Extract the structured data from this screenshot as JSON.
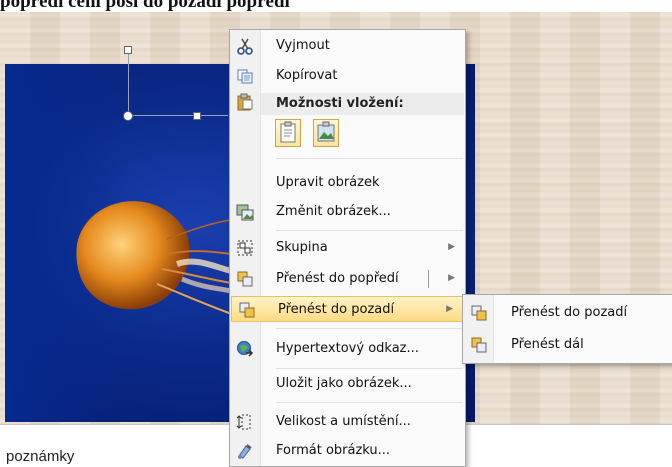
{
  "top_text": "popředí  čení  posl  do pozadí  popředí",
  "notes_label": "poznámky",
  "context_menu": {
    "cut": "Vyjmout",
    "copy": "Kopírovat",
    "paste_options_header": "Možnosti vložení:",
    "edit_picture": "Upravit obrázek",
    "change_picture": "Změnit obrázek...",
    "group": "Skupina",
    "bring_to_front": "Přenést do popředí",
    "send_to_back": "Přenést do pozadí",
    "hyperlink": "Hypertextový odkaz...",
    "save_as_picture": "Uložit jako obrázek...",
    "size_position": "Velikost a umístění...",
    "format_picture": "Formát obrázku..."
  },
  "submenu": {
    "send_to_back": "Přenést do pozadí",
    "send_backward": "Přenést dál"
  },
  "colors": {
    "highlight": "#fedb84",
    "menu_bg": "#fafafa",
    "slide_picture": "#0a2a8a"
  }
}
